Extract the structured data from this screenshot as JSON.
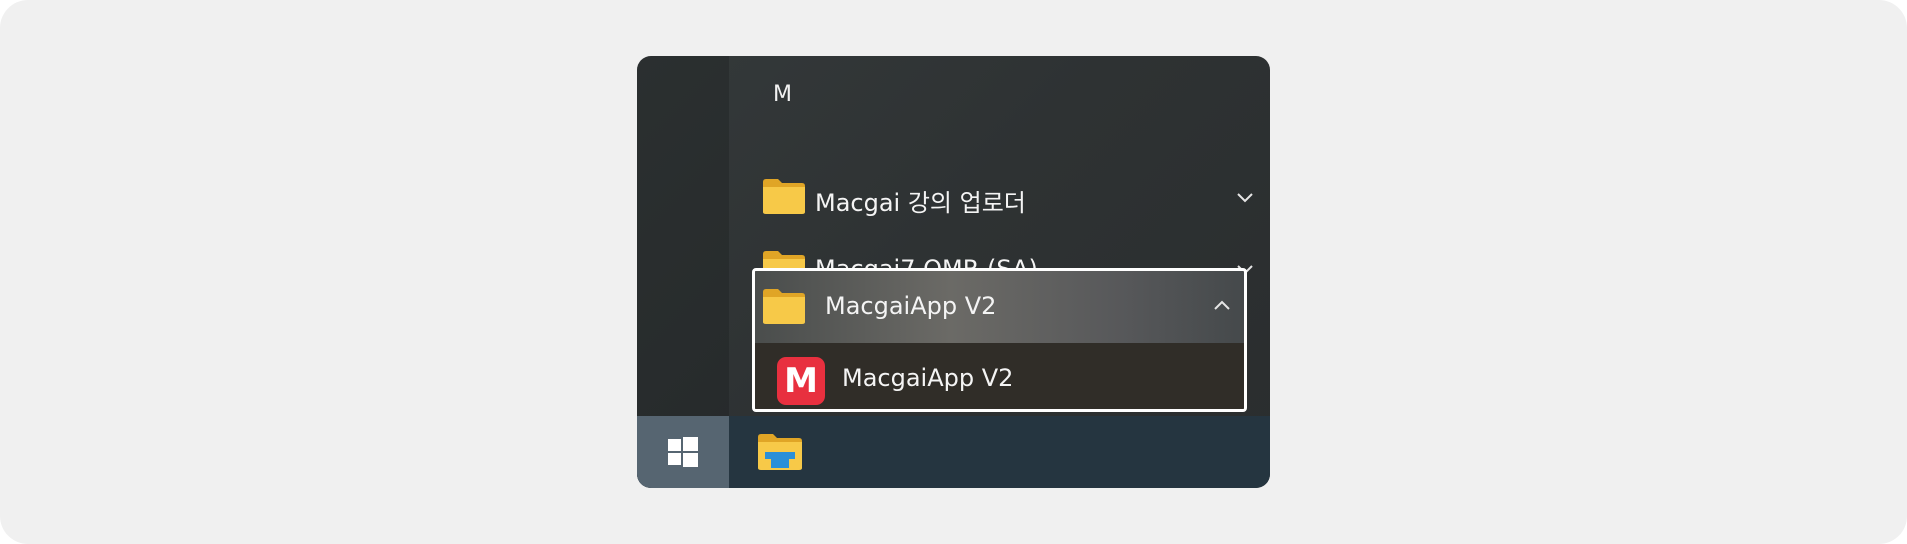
{
  "section_letter": "M",
  "items": [
    {
      "label": "Macgai 강의 업로더",
      "icon": "folder-icon",
      "chevron": "chevron-down"
    },
    {
      "label": "Macgai7 OMR (SA)",
      "icon": "folder-icon",
      "chevron": "chevron-down"
    },
    {
      "label": "MacgaiApp V2",
      "icon": "folder-icon",
      "chevron": "chevron-up",
      "expanded": true
    }
  ],
  "sub_item": {
    "label": "MacgaiApp V2",
    "icon_letter": "M",
    "icon_color": "#e8303f"
  },
  "taskbar": {
    "start": "windows-icon",
    "pinned": [
      "file-explorer-icon"
    ]
  },
  "colors": {
    "highlight_border": "#ffffff",
    "taskbar": "#253540",
    "start_button": "#566571",
    "folder": "#f2c042"
  }
}
